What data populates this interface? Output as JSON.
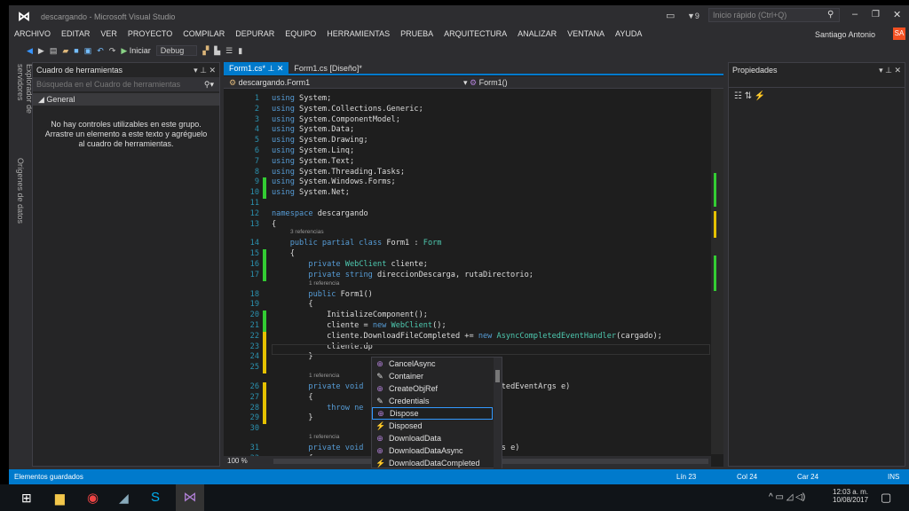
{
  "window": {
    "title": "descargando - Microsoft Visual Studio",
    "notif_count": "9",
    "quick_launch": "Inicio rápido (Ctrl+Q)",
    "user": "Santiago Antonio",
    "user_initials": "SA",
    "accent": "#007acc",
    "avatar_color": "#f25022"
  },
  "menu": [
    "ARCHIVO",
    "EDITAR",
    "VER",
    "PROYECTO",
    "COMPILAR",
    "DEPURAR",
    "EQUIPO",
    "HERRAMIENTAS",
    "PRUEBA",
    "ARQUITECTURA",
    "ANALIZAR",
    "VENTANA",
    "AYUDA"
  ],
  "toolbar": {
    "start": "Iniciar",
    "config": "Debug"
  },
  "side_tabs": [
    "Explorador de servidores",
    "Orígenes de datos"
  ],
  "toolbox": {
    "title": "Cuadro de herramientas",
    "search_placeholder": "Búsqueda en el Cuadro de herramientas",
    "group": "General",
    "empty_message": "No hay controles utilizables en este grupo. Arrastre un elemento a este texto y agréguelo al cuadro de herramientas."
  },
  "tabs": [
    {
      "label": "Form1.cs*",
      "active": true
    },
    {
      "label": "Form1.cs [Diseño]*",
      "active": false
    }
  ],
  "nav": {
    "class": "descargando.Form1",
    "member": "Form1()"
  },
  "code": [
    {
      "n": "1",
      "t": [
        [
          "using",
          "kw"
        ],
        [
          " System;",
          ""
        ]
      ]
    },
    {
      "n": "2",
      "t": [
        [
          "using",
          "kw"
        ],
        [
          " System.Collections.Generic;",
          ""
        ]
      ]
    },
    {
      "n": "3",
      "t": [
        [
          "using",
          "kw"
        ],
        [
          " System.ComponentModel;",
          ""
        ]
      ]
    },
    {
      "n": "4",
      "t": [
        [
          "using",
          "kw"
        ],
        [
          " System.Data;",
          ""
        ]
      ]
    },
    {
      "n": "5",
      "t": [
        [
          "using",
          "kw"
        ],
        [
          " System.Drawing;",
          ""
        ]
      ]
    },
    {
      "n": "6",
      "t": [
        [
          "using",
          "kw"
        ],
        [
          " System.Linq;",
          ""
        ]
      ]
    },
    {
      "n": "7",
      "t": [
        [
          "using",
          "kw"
        ],
        [
          " System.Text;",
          ""
        ]
      ]
    },
    {
      "n": "8",
      "t": [
        [
          "using",
          "kw"
        ],
        [
          " System.Threading.Tasks;",
          ""
        ]
      ]
    },
    {
      "n": "9",
      "t": [
        [
          "using",
          "kw"
        ],
        [
          " System.Windows.Forms;",
          ""
        ]
      ]
    },
    {
      "n": "10",
      "t": [
        [
          "using",
          "kw"
        ],
        [
          " System.Net;",
          ""
        ]
      ]
    },
    {
      "n": "11",
      "t": []
    },
    {
      "n": "12",
      "t": [
        [
          "namespace",
          "kw"
        ],
        [
          " descargando",
          ""
        ]
      ]
    },
    {
      "n": "13",
      "t": [
        [
          "{",
          ""
        ]
      ]
    },
    {
      "hint": "3 referencias",
      "i": 1
    },
    {
      "n": "14",
      "t": [
        [
          "    public partial class ",
          "kw"
        ],
        [
          "Form1",
          ""
        ],
        [
          " : ",
          ""
        ],
        [
          "Form",
          "ty"
        ]
      ]
    },
    {
      "n": "15",
      "t": [
        [
          "    {",
          ""
        ]
      ]
    },
    {
      "n": "16",
      "t": [
        [
          "        private ",
          "kw"
        ],
        [
          "WebClient",
          "ty"
        ],
        [
          " cliente;",
          ""
        ]
      ]
    },
    {
      "n": "17",
      "t": [
        [
          "        private string",
          "kw"
        ],
        [
          " direccionDescarga, rutaDirectorio;",
          ""
        ]
      ]
    },
    {
      "hint": "1 referencia",
      "i": 2
    },
    {
      "n": "18",
      "t": [
        [
          "        public",
          "kw"
        ],
        [
          " Form1()",
          ""
        ]
      ]
    },
    {
      "n": "19",
      "t": [
        [
          "        {",
          ""
        ]
      ]
    },
    {
      "n": "20",
      "t": [
        [
          "            InitializeComponent();",
          ""
        ]
      ]
    },
    {
      "n": "21",
      "t": [
        [
          "            cliente = ",
          ""
        ],
        [
          "new ",
          "kw"
        ],
        [
          "WebClient",
          "ty"
        ],
        [
          "();",
          ""
        ]
      ]
    },
    {
      "n": "22",
      "t": [
        [
          "            cliente.DownloadFileCompleted += ",
          ""
        ],
        [
          "new ",
          "kw"
        ],
        [
          "AsyncCompletedEventHandler",
          "ty"
        ],
        [
          "(cargado);",
          ""
        ]
      ]
    },
    {
      "n": "23",
      "t": [
        [
          "            cliente.dp",
          ""
        ]
      ]
    },
    {
      "n": "24",
      "t": [
        [
          "        }",
          ""
        ]
      ]
    },
    {
      "n": "25",
      "t": []
    },
    {
      "hint": "1 referencia",
      "i": 2
    },
    {
      "n": "26",
      "t": [
        [
          "        private void",
          "kw"
        ],
        [
          "                        ",
          ""
        ],
        [
          "CompletedEventArgs e)",
          ""
        ]
      ]
    },
    {
      "n": "27",
      "t": [
        [
          "        {",
          ""
        ]
      ]
    },
    {
      "n": "28",
      "t": [
        [
          "            throw ne",
          "kw"
        ]
      ]
    },
    {
      "n": "29",
      "t": [
        [
          "        }",
          ""
        ]
      ]
    },
    {
      "n": "30",
      "t": []
    },
    {
      "hint": "1 referencia",
      "i": 2
    },
    {
      "n": "31",
      "t": [
        [
          "        private void",
          "kw"
        ],
        [
          "                        ",
          ""
        ],
        [
          "entArgs e)",
          ""
        ]
      ]
    },
    {
      "n": "32",
      "t": [
        [
          "        {",
          ""
        ]
      ]
    }
  ],
  "autocomplete": [
    {
      "label": "CancelAsync",
      "icon": "method-icon"
    },
    {
      "label": "Container",
      "icon": "property-icon"
    },
    {
      "label": "CreateObjRef",
      "icon": "method-icon"
    },
    {
      "label": "Credentials",
      "icon": "property-icon"
    },
    {
      "label": "Dispose",
      "icon": "method-icon",
      "selected": true
    },
    {
      "label": "Disposed",
      "icon": "event-icon"
    },
    {
      "label": "DownloadData",
      "icon": "method-icon"
    },
    {
      "label": "DownloadDataAsync",
      "icon": "method-icon"
    },
    {
      "label": "DownloadDataCompleted",
      "icon": "event-icon"
    }
  ],
  "zoom": "100 %",
  "properties": {
    "title": "Propiedades"
  },
  "status": {
    "message": "Elementos guardados",
    "line": "Lín 23",
    "col": "Col 24",
    "car": "Car 24",
    "mode": "INS"
  },
  "taskbar": {
    "time": "12:03 a. m.",
    "date": "10/08/2017"
  }
}
